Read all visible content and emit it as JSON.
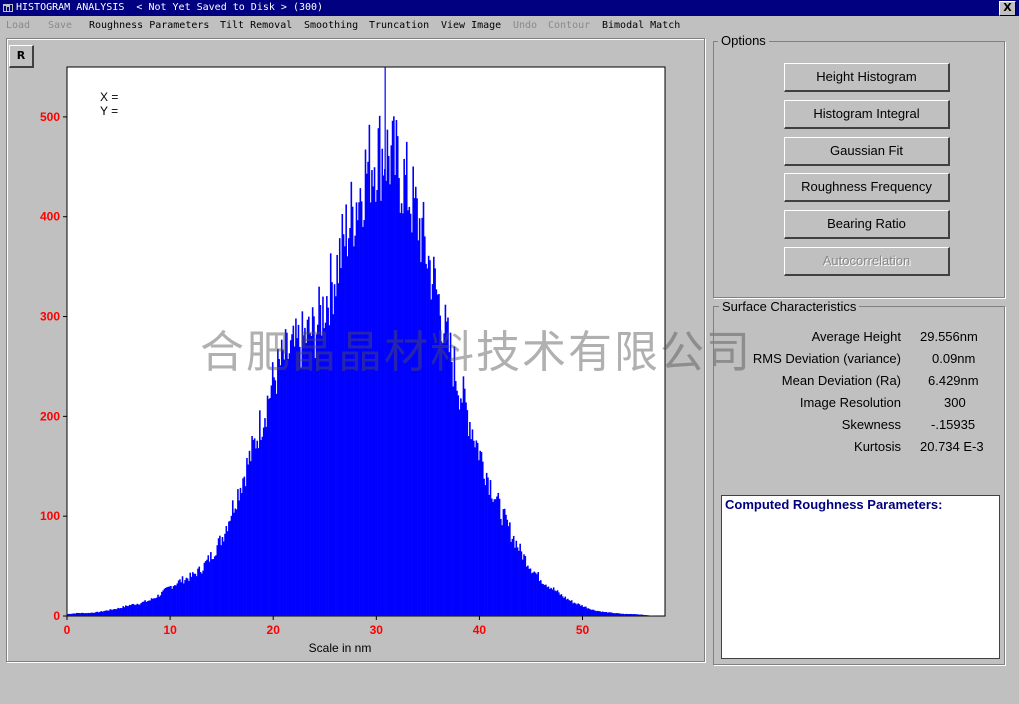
{
  "window": {
    "title": "HISTOGRAM ANALYSIS  < Not Yet Saved to Disk > (300)",
    "close_label": "X"
  },
  "menu": [
    {
      "label": "Load",
      "enabled": false
    },
    {
      "label": "Save",
      "enabled": false
    },
    {
      "label": "Roughness Parameters",
      "enabled": true
    },
    {
      "label": "Tilt Removal",
      "enabled": true
    },
    {
      "label": "Smoothing",
      "enabled": true
    },
    {
      "label": "Truncation",
      "enabled": true
    },
    {
      "label": "View Image",
      "enabled": true
    },
    {
      "label": "Undo",
      "enabled": false
    },
    {
      "label": "Contour",
      "enabled": false
    },
    {
      "label": "Bimodal Match",
      "enabled": true
    }
  ],
  "plot": {
    "reset_button": "R",
    "cursor_x_label": "X =",
    "cursor_y_label": "Y ="
  },
  "chart_data": {
    "type": "bar",
    "xlabel": "Scale in nm",
    "ylabel": "",
    "xlim": [
      0,
      58
    ],
    "ylim": [
      0,
      550
    ],
    "x_ticks": [
      0,
      10,
      20,
      30,
      40,
      50
    ],
    "y_ticks": [
      0,
      100,
      200,
      300,
      400,
      500
    ],
    "bar_color": "#0000ff",
    "tick_color": "#ff0000",
    "x": [
      0,
      1,
      2,
      3,
      4,
      5,
      6,
      7,
      8,
      9,
      10,
      11,
      12,
      13,
      14,
      15,
      16,
      17,
      18,
      19,
      20,
      21,
      22,
      23,
      24,
      25,
      26,
      27,
      28,
      29,
      30,
      31,
      32,
      33,
      34,
      35,
      36,
      37,
      38,
      39,
      40,
      41,
      42,
      43,
      44,
      45,
      46,
      47,
      48,
      49,
      50,
      51,
      52,
      53,
      54,
      55,
      56,
      57
    ],
    "values": [
      2,
      3,
      3,
      4,
      6,
      8,
      11,
      13,
      16,
      22,
      30,
      36,
      40,
      48,
      62,
      80,
      110,
      140,
      170,
      205,
      240,
      262,
      270,
      282,
      290,
      318,
      348,
      388,
      420,
      452,
      470,
      468,
      455,
      432,
      400,
      360,
      318,
      270,
      232,
      198,
      164,
      134,
      106,
      84,
      64,
      48,
      36,
      28,
      20,
      14,
      10,
      6,
      4,
      3,
      2,
      2,
      1,
      0
    ],
    "peak_spike": {
      "x": 30.8,
      "value": 550
    }
  },
  "options": {
    "title": "Options",
    "buttons": [
      {
        "label": "Height Histogram",
        "enabled": true
      },
      {
        "label": "Histogram Integral",
        "enabled": true
      },
      {
        "label": "Gaussian Fit",
        "enabled": true
      },
      {
        "label": "Roughness Frequency",
        "enabled": true
      },
      {
        "label": "Bearing Ratio",
        "enabled": true
      },
      {
        "label": "Autocorrelation",
        "enabled": false
      }
    ]
  },
  "surface": {
    "title": "Surface Characteristics",
    "stats": [
      {
        "label": "Average Height",
        "value": "29.556nm"
      },
      {
        "label": "RMS Deviation (variance)",
        "value": "0.09nm"
      },
      {
        "label": "Mean Deviation (Ra)",
        "value": "6.429nm"
      },
      {
        "label": "Image Resolution",
        "value": "300"
      },
      {
        "label": "Skewness",
        "value": "-.15935"
      },
      {
        "label": "Kurtosis",
        "value": "20.734 E-3"
      }
    ]
  },
  "computed": {
    "title": "Computed Roughness Parameters:"
  },
  "watermark": "合肥晶晶材料技术有限公司"
}
